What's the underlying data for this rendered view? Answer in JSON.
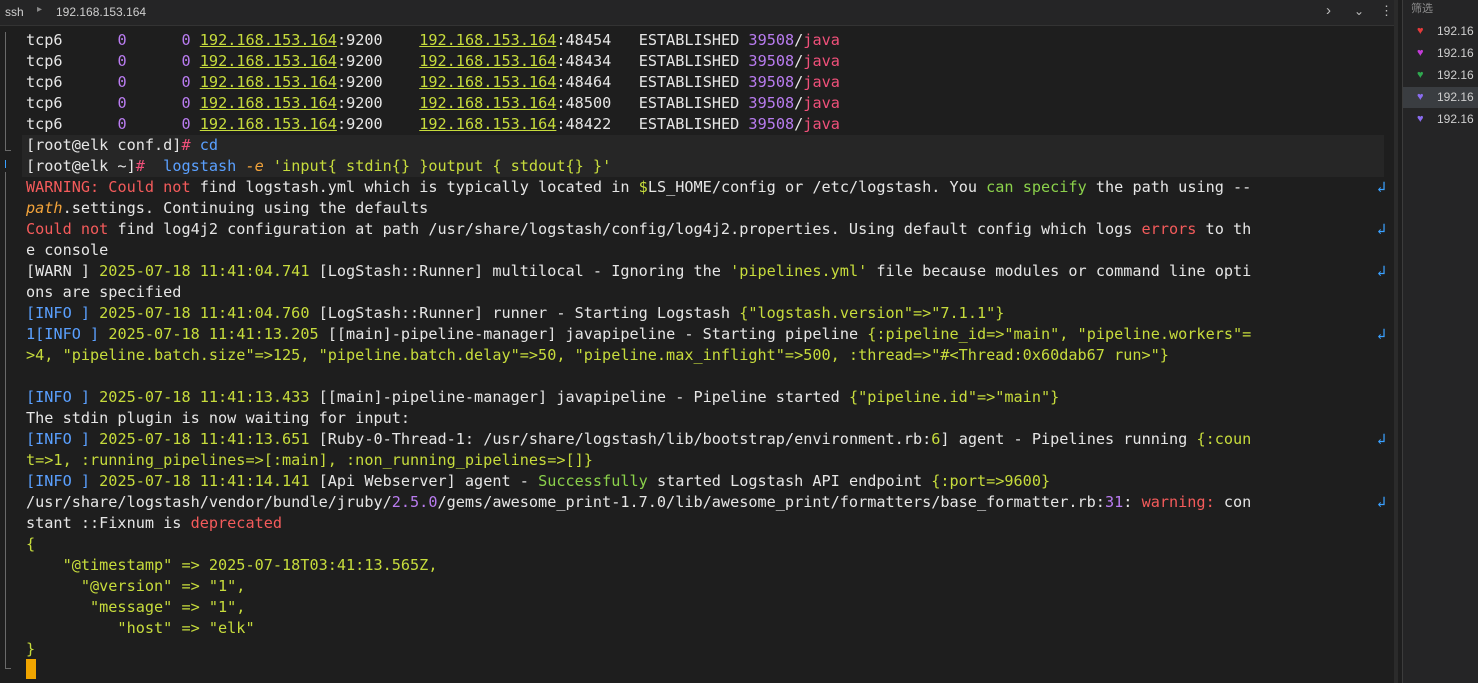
{
  "topbar": {
    "app": "ssh",
    "host": "192.168.153.164"
  },
  "colors": {
    "plain": "#e6e6e6",
    "green": "#8bd14b",
    "yellowgreen": "#c7dc3c",
    "purple": "#b97cf0",
    "pink": "#f0507a",
    "red": "#f45b5b",
    "blue": "#5aa0ff",
    "gray": "#c9c9c9",
    "orange": "#f2a33a",
    "cyan": "#36b7c9"
  },
  "terminal": {
    "lines": [
      {
        "segs": [
          [
            "tcp6      ",
            "plain"
          ],
          [
            "0",
            "purple"
          ],
          [
            "      ",
            "plain"
          ],
          [
            "0",
            "purple"
          ],
          [
            " ",
            "plain"
          ],
          [
            "192.168.153.164",
            "yellowgreen",
            "ul"
          ],
          [
            ":9200",
            "plain"
          ],
          [
            "    ",
            "plain"
          ],
          [
            "192.168.153.164",
            "yellowgreen",
            "ul"
          ],
          [
            ":48454",
            "plain"
          ],
          [
            "   ESTABLISHED ",
            "plain"
          ],
          [
            "39508",
            "purple"
          ],
          [
            "/",
            "plain"
          ],
          [
            "java",
            "pink"
          ]
        ]
      },
      {
        "segs": [
          [
            "tcp6      ",
            "plain"
          ],
          [
            "0",
            "purple"
          ],
          [
            "      ",
            "plain"
          ],
          [
            "0",
            "purple"
          ],
          [
            " ",
            "plain"
          ],
          [
            "192.168.153.164",
            "yellowgreen",
            "ul"
          ],
          [
            ":9200",
            "plain"
          ],
          [
            "    ",
            "plain"
          ],
          [
            "192.168.153.164",
            "yellowgreen",
            "ul"
          ],
          [
            ":48434",
            "plain"
          ],
          [
            "   ESTABLISHED ",
            "plain"
          ],
          [
            "39508",
            "purple"
          ],
          [
            "/",
            "plain"
          ],
          [
            "java",
            "pink"
          ]
        ]
      },
      {
        "segs": [
          [
            "tcp6      ",
            "plain"
          ],
          [
            "0",
            "purple"
          ],
          [
            "      ",
            "plain"
          ],
          [
            "0",
            "purple"
          ],
          [
            " ",
            "plain"
          ],
          [
            "192.168.153.164",
            "yellowgreen",
            "ul"
          ],
          [
            ":9200",
            "plain"
          ],
          [
            "    ",
            "plain"
          ],
          [
            "192.168.153.164",
            "yellowgreen",
            "ul"
          ],
          [
            ":48464",
            "plain"
          ],
          [
            "   ESTABLISHED ",
            "plain"
          ],
          [
            "39508",
            "purple"
          ],
          [
            "/",
            "plain"
          ],
          [
            "java",
            "pink"
          ]
        ]
      },
      {
        "segs": [
          [
            "tcp6      ",
            "plain"
          ],
          [
            "0",
            "purple"
          ],
          [
            "      ",
            "plain"
          ],
          [
            "0",
            "purple"
          ],
          [
            " ",
            "plain"
          ],
          [
            "192.168.153.164",
            "yellowgreen",
            "ul"
          ],
          [
            ":9200",
            "plain"
          ],
          [
            "    ",
            "plain"
          ],
          [
            "192.168.153.164",
            "yellowgreen",
            "ul"
          ],
          [
            ":48500",
            "plain"
          ],
          [
            "   ESTABLISHED ",
            "plain"
          ],
          [
            "39508",
            "purple"
          ],
          [
            "/",
            "plain"
          ],
          [
            "java",
            "pink"
          ]
        ]
      },
      {
        "segs": [
          [
            "tcp6      ",
            "plain"
          ],
          [
            "0",
            "purple"
          ],
          [
            "      ",
            "plain"
          ],
          [
            "0",
            "purple"
          ],
          [
            " ",
            "plain"
          ],
          [
            "192.168.153.164",
            "yellowgreen",
            "ul"
          ],
          [
            ":9200",
            "plain"
          ],
          [
            "    ",
            "plain"
          ],
          [
            "192.168.153.164",
            "yellowgreen",
            "ul"
          ],
          [
            ":48422",
            "plain"
          ],
          [
            "   ESTABLISHED ",
            "plain"
          ],
          [
            "39508",
            "purple"
          ],
          [
            "/",
            "plain"
          ],
          [
            "java",
            "pink"
          ]
        ]
      },
      {
        "hl": true,
        "segs": [
          [
            "[root@elk conf.d]",
            "plain"
          ],
          [
            "# ",
            "pink"
          ],
          [
            "cd",
            "blue"
          ]
        ]
      },
      {
        "hl": true,
        "segs": [
          [
            "[root@elk ~]",
            "plain"
          ],
          [
            "# ",
            "pink"
          ],
          [
            " logstash ",
            "blue"
          ],
          [
            "-e",
            "orange",
            "it"
          ],
          [
            " 'input{ stdin{} }output { stdout{} }'",
            "yellowgreen"
          ]
        ]
      },
      {
        "wrap": true,
        "segs": [
          [
            "WARNING:",
            "red"
          ],
          [
            " Could not ",
            "red"
          ],
          [
            "find logstash.yml which is typically located in ",
            "plain"
          ],
          [
            "$",
            "yellowgreen"
          ],
          [
            "LS_HOME/config or /etc/logstash. You ",
            "plain"
          ],
          [
            "can specify",
            "green"
          ],
          [
            " the path using --",
            "plain"
          ]
        ]
      },
      {
        "segs": [
          [
            "path",
            "orange",
            "it"
          ],
          [
            ".settings. Continuing using the defaults",
            "plain"
          ]
        ]
      },
      {
        "wrap": true,
        "segs": [
          [
            "Could not",
            "red"
          ],
          [
            " find log4j2 configuration at path /usr/share/logstash/config/log4j2.properties. Using default config which logs ",
            "plain"
          ],
          [
            "errors",
            "red"
          ],
          [
            " to th",
            "plain"
          ]
        ]
      },
      {
        "segs": [
          [
            "e console",
            "plain"
          ]
        ]
      },
      {
        "wrap": true,
        "segs": [
          [
            "[WARN ] ",
            "plain"
          ],
          [
            "2025-07-18 11:41:04.741",
            "yellowgreen"
          ],
          [
            " [LogStash::Runner] multilocal - Ignoring the ",
            "plain"
          ],
          [
            "'pipelines.yml'",
            "yellowgreen"
          ],
          [
            " file because modules or command line opti",
            "plain"
          ]
        ]
      },
      {
        "segs": [
          [
            "ons are specified",
            "plain"
          ]
        ]
      },
      {
        "segs": [
          [
            "[INFO ] ",
            "blue"
          ],
          [
            "2025-07-18 11:41:04.760",
            "yellowgreen"
          ],
          [
            " [LogStash::Runner] runner - Starting Logstash ",
            "plain"
          ],
          [
            "{\"logstash.version\"=>\"7.1.1\"}",
            "yellowgreen"
          ]
        ]
      },
      {
        "wrap": true,
        "segs": [
          [
            "1",
            "blue"
          ],
          [
            "[INFO ] ",
            "blue"
          ],
          [
            "2025-07-18 11:41:13.205",
            "yellowgreen"
          ],
          [
            " [[main]-pipeline-manager] javapipeline - Starting pipeline ",
            "plain"
          ],
          [
            "{:pipeline_id=>\"main\", \"pipeline.workers\"=",
            "yellowgreen"
          ]
        ]
      },
      {
        "segs": [
          [
            ">4, \"pipeline.batch.size\"=>125, \"pipeline.batch.delay\"=>50, \"pipeline.max_inflight\"=>500, :thread=>\"#<Thread:0x60dab67 run>\"}",
            "yellowgreen"
          ]
        ]
      },
      {
        "segs": [
          [
            "",
            "plain"
          ]
        ]
      },
      {
        "segs": [
          [
            "[INFO ] ",
            "blue"
          ],
          [
            "2025-07-18 11:41:13.433",
            "yellowgreen"
          ],
          [
            " [[main]-pipeline-manager] javapipeline - Pipeline started ",
            "plain"
          ],
          [
            "{\"pipeline.id\"=>\"main\"}",
            "yellowgreen"
          ]
        ]
      },
      {
        "segs": [
          [
            "The stdin plugin is now waiting for input:",
            "plain"
          ]
        ]
      },
      {
        "wrap": true,
        "segs": [
          [
            "[INFO ] ",
            "blue"
          ],
          [
            "2025-07-18 11:41:13.651",
            "yellowgreen"
          ],
          [
            " [Ruby-0-Thread-1: /usr/share/logstash/lib/bootstrap/environment.rb:",
            "plain"
          ],
          [
            "6",
            "yellowgreen"
          ],
          [
            "] agent - Pipelines running ",
            "plain"
          ],
          [
            "{:coun",
            "yellowgreen"
          ]
        ]
      },
      {
        "segs": [
          [
            "t=>1, :running_pipelines=>[:main], :non_running_pipelines=>[]}",
            "yellowgreen"
          ]
        ]
      },
      {
        "segs": [
          [
            "[INFO ] ",
            "blue"
          ],
          [
            "2025-07-18 11:41:14.141",
            "yellowgreen"
          ],
          [
            " [Api Webserver] agent - ",
            "plain"
          ],
          [
            "Successfully",
            "green"
          ],
          [
            " started Logstash API endpoint ",
            "plain"
          ],
          [
            "{:port=>9600}",
            "yellowgreen"
          ]
        ]
      },
      {
        "wrap": true,
        "segs": [
          [
            "/usr/share/logstash/vendor/bundle/jruby/",
            "plain"
          ],
          [
            "2.5.0",
            "purple"
          ],
          [
            "/gems/awesome_print-1.7.0/lib/awesome_print/formatters/base_formatter.rb:",
            "plain"
          ],
          [
            "31",
            "purple"
          ],
          [
            ": ",
            "plain"
          ],
          [
            "warning:",
            "red"
          ],
          [
            " con",
            "plain"
          ]
        ]
      },
      {
        "segs": [
          [
            "stant ::Fixnum is ",
            "plain"
          ],
          [
            "deprecated",
            "red"
          ]
        ]
      },
      {
        "segs": [
          [
            "{",
            "yellowgreen"
          ]
        ]
      },
      {
        "segs": [
          [
            "    \"@timestamp\" => ",
            "yellowgreen"
          ],
          [
            "2025-07-18T03:41:13.565Z,",
            "yellowgreen"
          ]
        ]
      },
      {
        "segs": [
          [
            "      \"@version\" => \"1\",",
            "yellowgreen"
          ]
        ]
      },
      {
        "segs": [
          [
            "       \"message\" => \"1\",",
            "yellowgreen"
          ]
        ]
      },
      {
        "segs": [
          [
            "          \"host\" => \"elk\"",
            "yellowgreen"
          ]
        ]
      },
      {
        "segs": [
          [
            "}",
            "yellowgreen"
          ]
        ]
      }
    ],
    "wrap_glyph": "↲"
  },
  "sidebar": {
    "header": "筛选",
    "items": [
      {
        "label": "192.16",
        "heart": "#e33a3a"
      },
      {
        "label": "192.16",
        "heart": "#c33bd8"
      },
      {
        "label": "192.16",
        "heart": "#2fa84f"
      },
      {
        "label": "192.16",
        "heart": "#8a6cf0",
        "selected": true
      },
      {
        "label": "192.16",
        "heart": "#8a6cf0"
      }
    ]
  }
}
